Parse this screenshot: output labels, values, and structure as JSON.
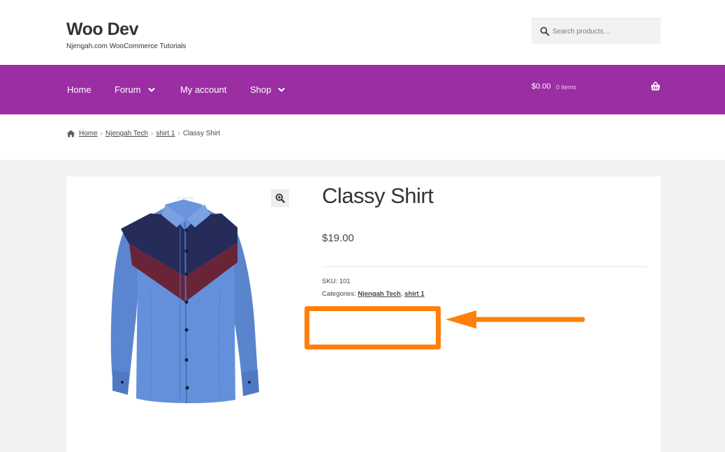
{
  "header": {
    "site_title": "Woo Dev",
    "site_description": "Njengah.com WooCommerce Tutorials",
    "search": {
      "placeholder": "Search products…",
      "icon": "search-icon"
    }
  },
  "nav": {
    "items": [
      {
        "label": "Home",
        "has_dropdown": false
      },
      {
        "label": "Forum",
        "has_dropdown": true
      },
      {
        "label": "My account",
        "has_dropdown": false
      },
      {
        "label": "Shop",
        "has_dropdown": true
      }
    ],
    "cart": {
      "amount": "$0.00",
      "count": "0 items",
      "icon": "basket-icon"
    },
    "background": "#9b2ea3"
  },
  "breadcrumb": {
    "items": [
      "Home",
      "Njengah Tech",
      "shirt 1"
    ],
    "current": "Classy Shirt"
  },
  "product": {
    "title": "Classy Shirt",
    "price": "$19.00",
    "sku_label": "SKU:",
    "sku": "101",
    "categories_label": "Categories:",
    "categories": [
      "Njengah Tech",
      "shirt 1"
    ],
    "category_separator": ","
  },
  "annotation": {
    "color": "#ff7f0a"
  }
}
